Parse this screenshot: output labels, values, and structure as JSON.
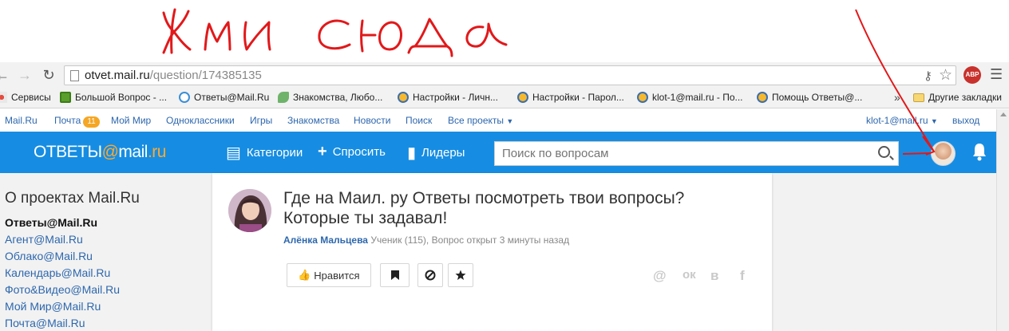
{
  "annotation": {
    "scrawl_text": "Жми сюда",
    "color": "#e2181a"
  },
  "browser": {
    "url_host": "otvet.mail.ru",
    "url_path": "/question/174385135",
    "abp_label": "ABP",
    "bookmarks": [
      "Сервисы",
      "Большой Вопрос - ...",
      "Ответы@Mail.Ru",
      "Знакомства, Любо...",
      "Настройки - Личн...",
      "Настройки - Парол...",
      "klot-1@mail.ru - По...",
      "Помощь Ответы@...",
      "Другие закладки"
    ],
    "bookmarks_more": "»"
  },
  "portal": {
    "links": [
      "Mail.Ru",
      "Почта",
      "Мой Мир",
      "Одноклассники",
      "Игры",
      "Знакомства",
      "Новости",
      "Поиск",
      "Все проекты"
    ],
    "mail_count": "11",
    "user_email": "klot-1@mail.ru",
    "logout": "выход"
  },
  "header": {
    "logo_left": "ОТВЕТЫ",
    "logo_at": "@",
    "logo_mail": "mail",
    "logo_ru": ".ru",
    "nav": [
      "Категории",
      "Спросить",
      "Лидеры"
    ],
    "search_placeholder": "Поиск по вопросам"
  },
  "sidebar": {
    "title": "О проектах Mail.Ru",
    "items": [
      "Ответы@Mail.Ru",
      "Агент@Mail.Ru",
      "Облако@Mail.Ru",
      "Календарь@Mail.Ru",
      "Фото&Видео@Mail.Ru",
      "Мой Мир@Mail.Ru",
      "Почта@Mail.Ru"
    ]
  },
  "question": {
    "title": "Где на Маил. ру Ответы посмотреть твои вопросы? Которые ты задавал!",
    "author": "Алёнка Мальцева",
    "meta": "Ученик (115), Вопрос открыт 3 минуты назад",
    "like_label": "Нравится",
    "share_icons": [
      "@",
      "ок",
      "в",
      "f"
    ]
  },
  "colors": {
    "header_blue": "#168de2",
    "link_blue": "#2d67ad",
    "logo_orange": "#ffa930"
  }
}
